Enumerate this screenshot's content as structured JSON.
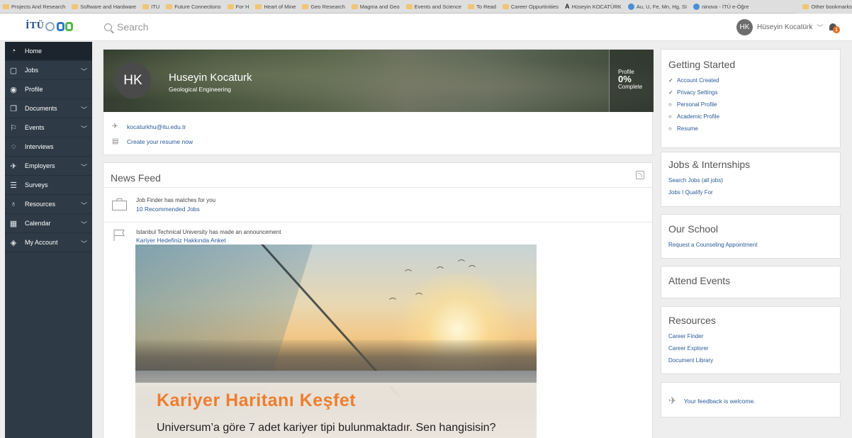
{
  "bookmarks": {
    "items": [
      {
        "label": "Projects And Research",
        "type": "folder"
      },
      {
        "label": "Software and Hardware",
        "type": "folder"
      },
      {
        "label": "ITU",
        "type": "folder"
      },
      {
        "label": "Future Connections",
        "type": "folder"
      },
      {
        "label": "For H",
        "type": "folder"
      },
      {
        "label": "Heart of Mine",
        "type": "folder"
      },
      {
        "label": "Geo Research",
        "type": "folder"
      },
      {
        "label": "Magma and Geo",
        "type": "folder"
      },
      {
        "label": "Events and Science",
        "type": "folder"
      },
      {
        "label": "To Read",
        "type": "folder"
      },
      {
        "label": "Career Oppurtinities",
        "type": "folder"
      },
      {
        "label": "Hüseyin KOCATÜRK",
        "type": "page-a"
      },
      {
        "label": "Au, U, Fe, Mn, Hg, SI",
        "type": "page"
      },
      {
        "label": "ninova - İTÜ e-Öğre",
        "type": "page"
      }
    ],
    "other": "Other bookmarks"
  },
  "header": {
    "logo_text": "İTÜ",
    "search_placeholder": "Search",
    "user_initials": "HK",
    "user_name": "Hüseyin Kocatürk",
    "notification_count": "1"
  },
  "sidebar": {
    "items": [
      {
        "label": "Home",
        "icon": "dashboard-icon",
        "glyph": "◔",
        "caret": false
      },
      {
        "label": "Jobs",
        "icon": "briefcase-icon",
        "glyph": "▢",
        "caret": true
      },
      {
        "label": "Profile",
        "icon": "profile-icon",
        "glyph": "◉",
        "caret": false
      },
      {
        "label": "Documents",
        "icon": "documents-icon",
        "glyph": "❐",
        "caret": true
      },
      {
        "label": "Events",
        "icon": "events-icon",
        "glyph": "⚐",
        "caret": true
      },
      {
        "label": "Interviews",
        "icon": "interviews-icon",
        "glyph": "◌",
        "caret": false
      },
      {
        "label": "Employers",
        "icon": "rocket-icon",
        "glyph": "✈",
        "caret": true
      },
      {
        "label": "Surveys",
        "icon": "list-icon",
        "glyph": "☰",
        "caret": false
      },
      {
        "label": "Resources",
        "icon": "lightbulb-icon",
        "glyph": "♁",
        "caret": true
      },
      {
        "label": "Calendar",
        "icon": "calendar-icon",
        "glyph": "▦",
        "caret": true
      },
      {
        "label": "My Account",
        "icon": "account-icon",
        "glyph": "◈",
        "caret": true
      }
    ]
  },
  "profile": {
    "initials": "HK",
    "name": "Huseyin Kocaturk",
    "department": "Geological Engineering",
    "complete_label": "Profile",
    "complete_pct": "0%",
    "complete_suffix": "Complete",
    "email": "kocaturkhu@itu.edu.tr",
    "resume_link": "Create your resume now"
  },
  "news_feed": {
    "title": "News Feed",
    "items": [
      {
        "title": "Job Finder has matches for you",
        "link": "10 Recommended Jobs"
      },
      {
        "title": "Istanbul Technical University has made an announcement",
        "link": "Kariyer Hedefiniz Hakkında Anket"
      }
    ],
    "announcement": {
      "headline": "Kariyer Haritanı Keşfet",
      "subline": "Universum’a göre 7 adet kariyer tipi bulunmaktadır. Sen hangisisin?"
    }
  },
  "right": {
    "getting_started": {
      "title": "Getting Started",
      "items": [
        {
          "label": "Account Created",
          "done": true,
          "mark": "✓"
        },
        {
          "label": "Privacy Settings",
          "done": true,
          "mark": "✓"
        },
        {
          "label": "Personal Profile",
          "done": false,
          "mark": "○"
        },
        {
          "label": "Academic Profile",
          "done": false,
          "mark": "○"
        },
        {
          "label": "Resume",
          "done": false,
          "mark": "○"
        }
      ]
    },
    "jobs": {
      "title": "Jobs & Internships",
      "links": [
        "Search Jobs (all jobs)",
        "Jobs I Qualify For"
      ]
    },
    "school": {
      "title": "Our School",
      "links": [
        "Request a Counseling Appointment"
      ]
    },
    "events": {
      "title": "Attend Events"
    },
    "resources": {
      "title": "Resources",
      "links": [
        "Career Finder",
        "Career Explorer",
        "Document Library"
      ]
    },
    "feedback": "Your feedback is welcome."
  },
  "colors": {
    "sidebar_bg": "#2e3a45",
    "link": "#2a5b99",
    "accent_orange": "#ef7d2e"
  }
}
